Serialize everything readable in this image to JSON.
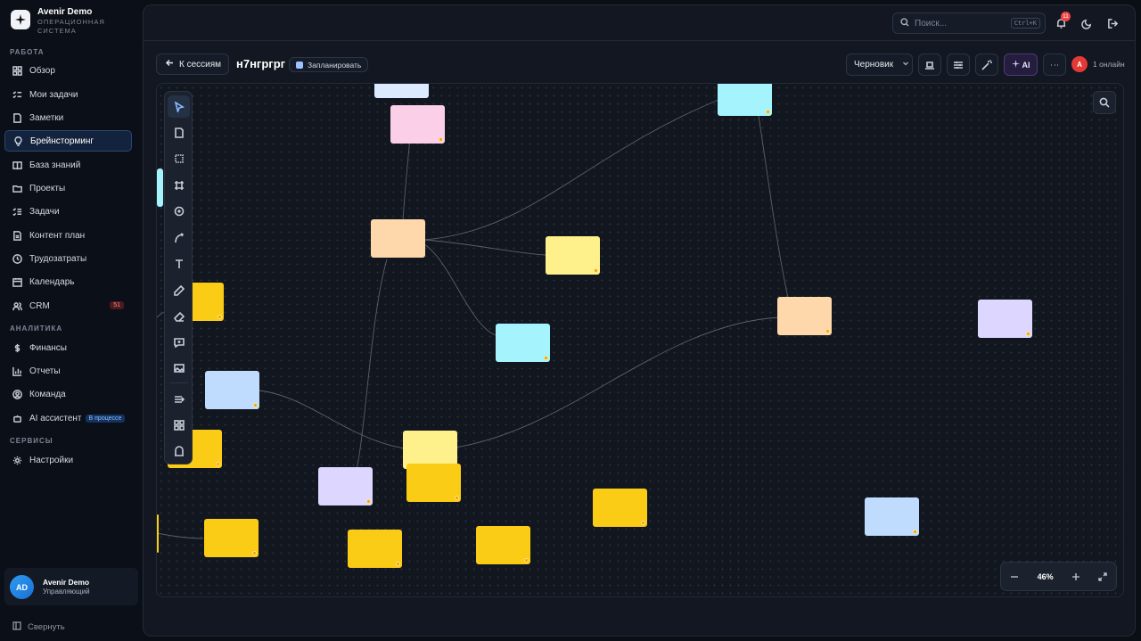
{
  "app": {
    "name": "Avenir Demo",
    "subtitle": "ОПЕРАЦИОННАЯ СИСТЕМА"
  },
  "sidebar": {
    "sections": [
      {
        "label": "РАБОТА"
      },
      {
        "label": "АНАЛИТИКА"
      },
      {
        "label": "СЕРВИСЫ"
      }
    ],
    "items": [
      {
        "label": "Обзор",
        "icon": "grid-icon"
      },
      {
        "label": "Мои задачи",
        "icon": "list-check-icon"
      },
      {
        "label": "Заметки",
        "icon": "note-icon"
      },
      {
        "label": "Брейнсторминг",
        "icon": "lightbulb-icon",
        "active": true
      },
      {
        "label": "База знаний",
        "icon": "book-icon"
      },
      {
        "label": "Проекты",
        "icon": "folder-icon"
      },
      {
        "label": "Задачи",
        "icon": "tasks-icon"
      },
      {
        "label": "Контент план",
        "icon": "document-icon"
      },
      {
        "label": "Трудозатраты",
        "icon": "clock-icon"
      },
      {
        "label": "Календарь",
        "icon": "calendar-icon"
      },
      {
        "label": "CRM",
        "icon": "users-icon",
        "badge": "51"
      },
      {
        "label": "Финансы",
        "icon": "dollar-icon"
      },
      {
        "label": "Отчеты",
        "icon": "bar-chart-icon"
      },
      {
        "label": "Команда",
        "icon": "user-circle-icon"
      },
      {
        "label": "AI ассистент",
        "icon": "bot-icon",
        "badge": "В процессе"
      },
      {
        "label": "Настройки",
        "icon": "gear-icon"
      }
    ],
    "user": {
      "initials": "AD",
      "name": "Avenir Demo",
      "role": "Управляющий"
    },
    "collapse_label": "Свернуть"
  },
  "topbar": {
    "search_placeholder": "Поиск...",
    "search_shortcut": "Ctrl+K",
    "notifications_count": "11"
  },
  "session": {
    "back_label": "К сессиям",
    "title": "н7нгргрг",
    "schedule_label": "Запланировать",
    "status": "Черновик",
    "ai_label": "AI",
    "online_initial": "A",
    "online_label": "1 онлайн"
  },
  "canvas": {
    "zoom_level": "46%",
    "note_colors": {
      "pink": "#fbcfe8",
      "peach": "#fed7aa",
      "yellow": "#fef08a",
      "gold": "#facc15",
      "cyan": "#a5f3fc",
      "blue": "#bfdbfe",
      "lavender": "#ddd6fe",
      "lightblue": "#dbeafe"
    },
    "tools": [
      "cursor-icon",
      "sticky-note-icon",
      "rectangle-icon",
      "frame-icon",
      "circle-icon",
      "connector-icon",
      "text-icon",
      "pencil-icon",
      "eraser-icon",
      "comment-icon",
      "image-icon",
      "layout-icon",
      "apps-icon",
      "template-icon"
    ]
  }
}
